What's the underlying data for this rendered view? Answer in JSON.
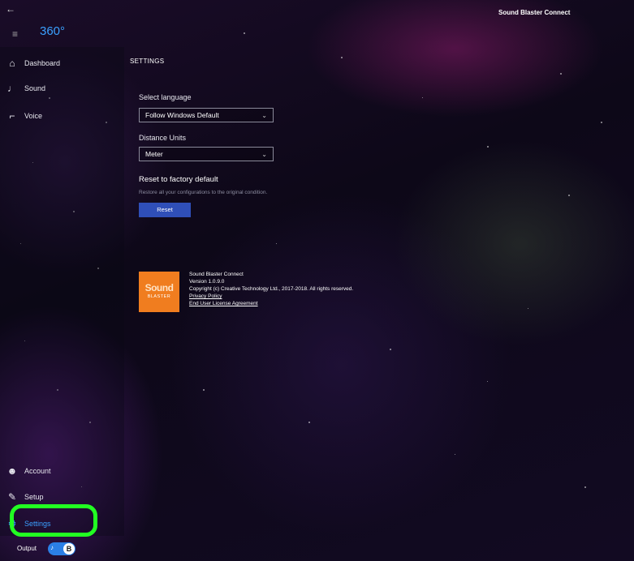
{
  "app": {
    "title": "Sound Blaster Connect",
    "brand": "360°",
    "back_icon": "arrow-left-icon"
  },
  "sidebar": {
    "items": [
      {
        "label": "Dashboard",
        "icon": "home-icon"
      },
      {
        "label": "Sound",
        "icon": "music-note-icon"
      },
      {
        "label": "Voice",
        "icon": "microphone-icon"
      },
      {
        "label": "Account",
        "icon": "person-icon"
      },
      {
        "label": "Setup",
        "icon": "wrench-icon"
      },
      {
        "label": "Settings",
        "icon": "gear-icon",
        "active": true
      }
    ],
    "output": {
      "label": "Output",
      "toggle_left": "♪",
      "toggle_right": "B",
      "on": true
    }
  },
  "main": {
    "title": "SETTINGS",
    "language": {
      "label": "Select language",
      "value": "Follow Windows Default"
    },
    "distance": {
      "label": "Distance Units",
      "value": "Meter"
    },
    "reset": {
      "heading": "Reset to factory default",
      "description": "Restore all your configurations to the original condition.",
      "button": "Reset"
    },
    "about": {
      "logo_word": "Sound",
      "logo_sub": "BLASTER",
      "product": "Sound Blaster Connect",
      "version": "Version 1.0.9.0",
      "copyright": "Copyright (c) Creative Technology Ltd., 2017-2018. All rights reserved.",
      "privacy": "Privacy Policy",
      "eula": "End User License Agreement"
    }
  },
  "colors": {
    "accent": "#3aa0ff",
    "button": "#2f4fb8",
    "highlight": "#22ff22",
    "logo": "#f07d1f"
  }
}
